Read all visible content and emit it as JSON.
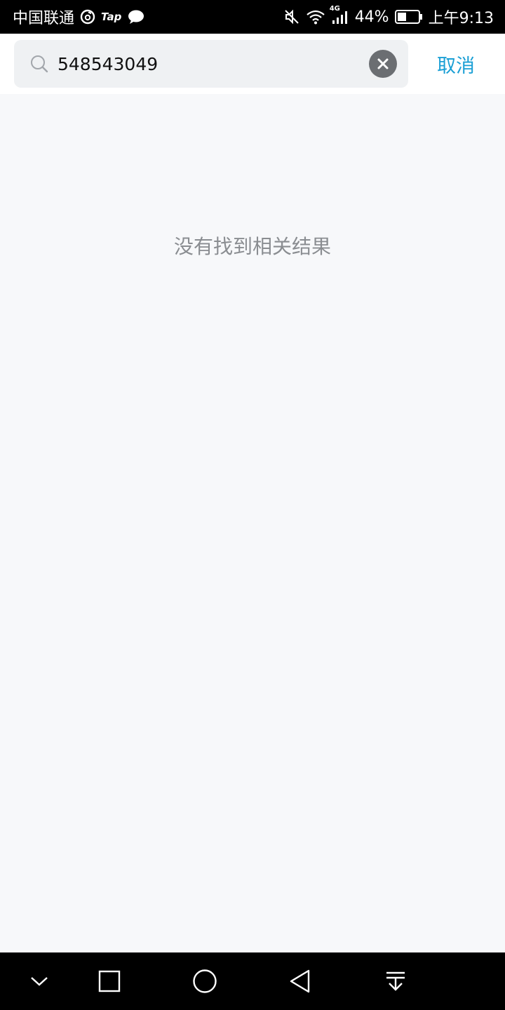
{
  "status_bar": {
    "carrier": "中国联通",
    "notification_icons": [
      "netease-music-icon",
      "taptap-icon",
      "message-bubble-icon"
    ],
    "tap_label": "Tap",
    "right_icons": [
      "mute-icon",
      "wifi-icon",
      "4g-signal-icon"
    ],
    "network_label": "4G",
    "battery_percent": "44%",
    "battery_level": 0.44,
    "time": "上午9:13"
  },
  "search": {
    "value": "548543049",
    "placeholder": "",
    "clear_icon": "clear-icon",
    "search_icon": "search-icon"
  },
  "header": {
    "cancel_label": "取消"
  },
  "results": {
    "empty_message": "没有找到相关结果"
  },
  "nav_bar": {
    "buttons": [
      "hide-navbar-icon",
      "recents-icon",
      "home-icon",
      "back-icon",
      "notification-pulldown-icon"
    ]
  },
  "colors": {
    "accent": "#1a9fd5",
    "page_background": "#f7f8fa",
    "search_background": "#eff1f3",
    "empty_text": "#8a8d91",
    "clear_button": "#6b6e72"
  }
}
